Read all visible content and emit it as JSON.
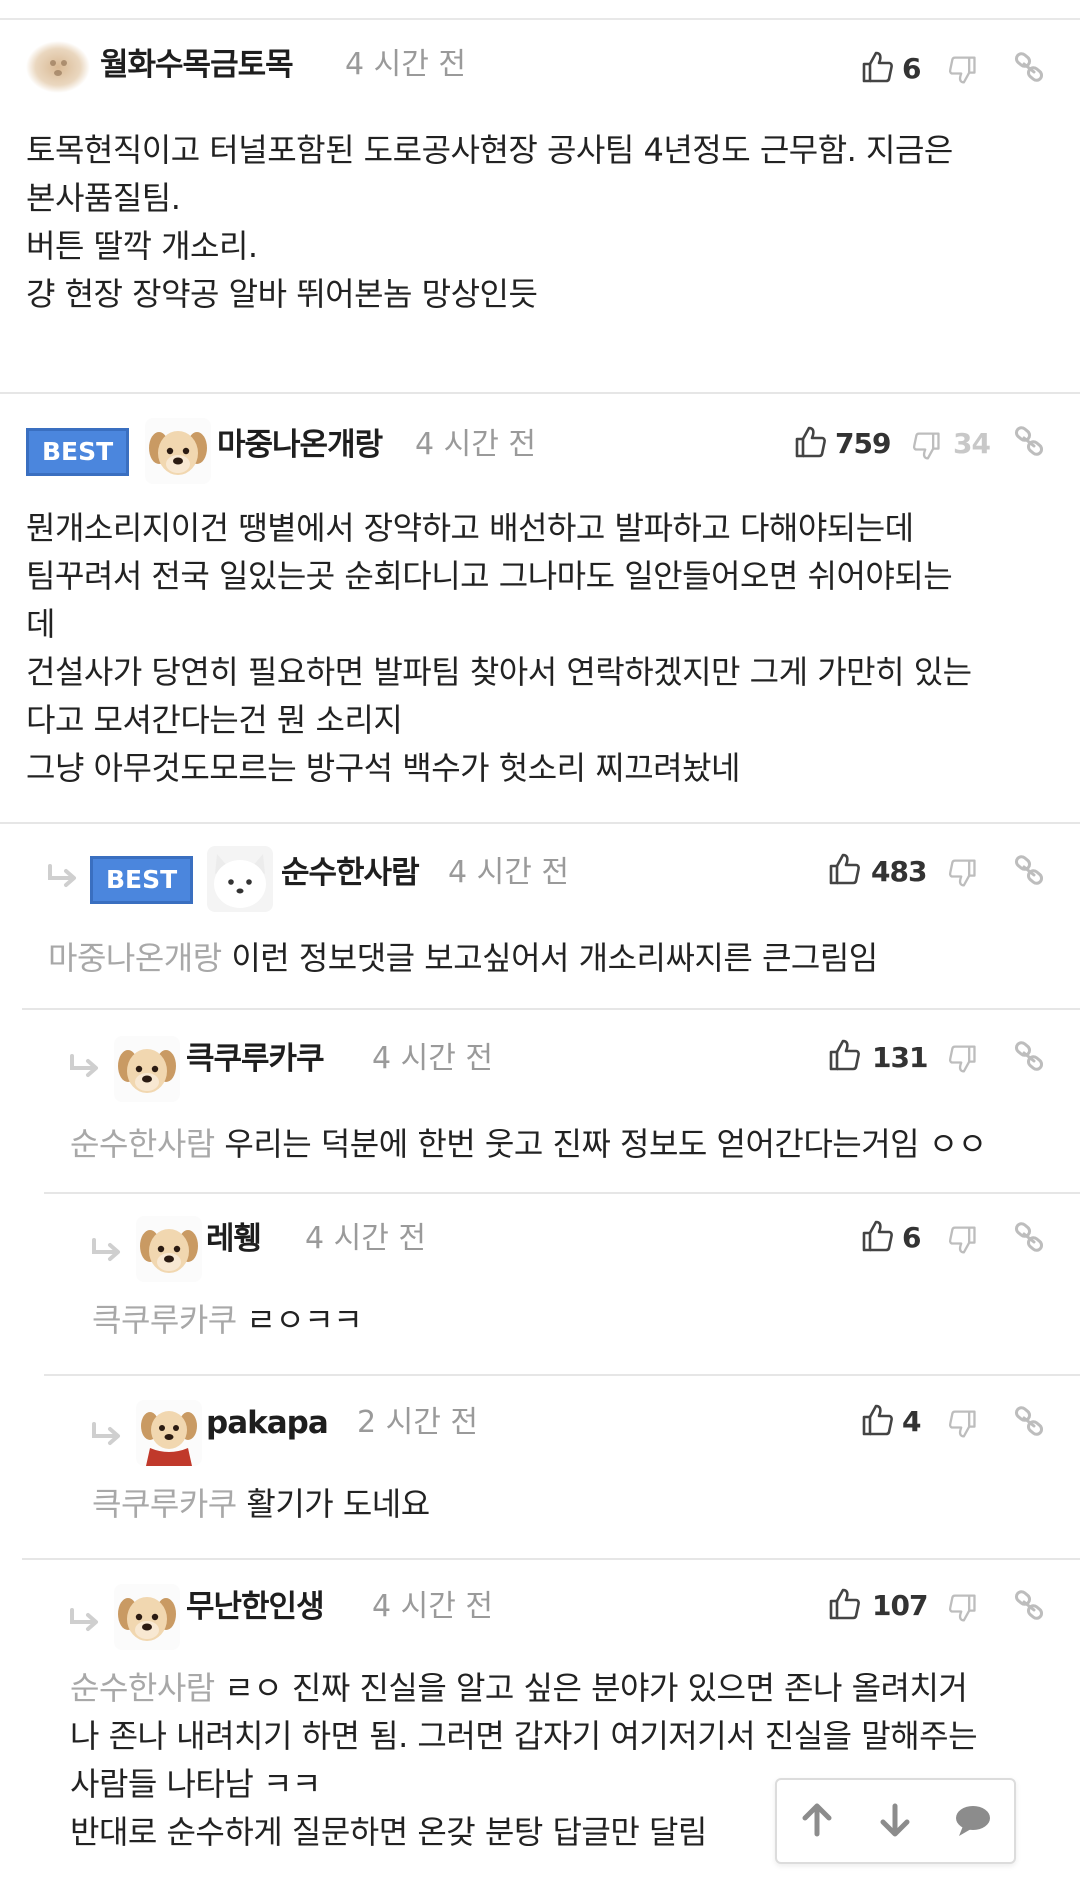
{
  "comments": [
    {
      "name": "월화수목금토목",
      "time": "4 시간 전",
      "up": "6",
      "down": "",
      "best": "",
      "mention": "",
      "lines": [
        "토목현직이고 터널포함된 도로공사현장 공사팀 4년정도 근무함. 지금은",
        "본사품질팀.",
        "",
        "버튼 딸깍 개소리.",
        "걍 현장 장약공 알바 뛰어본놈 망상인듯"
      ]
    },
    {
      "name": "마중나온개랑",
      "time": "4 시간 전",
      "up": "759",
      "down": "34",
      "best": "BEST",
      "mention": "",
      "lines": [
        "뭔개소리지이건 땡볕에서 장약하고 배선하고 발파하고 다해야되는데",
        "팀꾸려서 전국 일있는곳 순회다니고 그나마도 일안들어오면 쉬어야되는",
        "데",
        "건설사가 당연히 필요하면 발파팀 찾아서 연락하겠지만 그게 가만히 있는",
        "다고 모셔간다는건 뭔 소리지",
        "그냥 아무것도모르는 방구석 백수가 헛소리 찌끄려놨네"
      ]
    },
    {
      "name": "순수한사람",
      "time": "4 시간 전",
      "up": "483",
      "down": "",
      "best": "BEST",
      "mention": "마중나온개랑",
      "lines": [
        "이런 정보댓글 보고싶어서 개소리싸지른 큰그림임"
      ]
    },
    {
      "name": "큭쿠루카쿠",
      "time": "4 시간 전",
      "up": "131",
      "down": "",
      "best": "",
      "mention": "순수한사람",
      "lines": [
        "우리는 덕분에 한번 웃고 진짜 정보도 얻어간다는거임 ㅇㅇ"
      ]
    },
    {
      "name": "레휑",
      "time": "4 시간 전",
      "up": "6",
      "down": "",
      "best": "",
      "mention": "큭쿠루카쿠",
      "lines": [
        "ㄹㅇㅋㅋ"
      ]
    },
    {
      "name": "pakapa",
      "time": "2 시간 전",
      "up": "4",
      "down": "",
      "best": "",
      "mention": "큭쿠루카쿠",
      "lines": [
        "활기가 도네요"
      ]
    },
    {
      "name": "무난한인생",
      "time": "4 시간 전",
      "up": "107",
      "down": "",
      "best": "",
      "mention": "순수한사람",
      "lines": [
        "ㄹㅇ 진짜 진실을 알고 싶은 분야가 있으면 존나 올려치거",
        "나 존나 내려치기 하면 됨. 그러면 갑자기 여기저기서 진실을 말해주는",
        "사람들 나타남 ㅋㅋ",
        "반대로 순수하게 질문하면 온갖 분탕 답글만 달림"
      ]
    }
  ],
  "colors": {
    "best_bg": "#4b86dd",
    "mention": "#a8a8a8",
    "time": "#9a9a9a"
  },
  "icons": [
    "thumbs-up-icon",
    "thumbs-down-icon",
    "link-icon",
    "reply-arrow-icon",
    "scroll-up-icon",
    "scroll-down-icon",
    "chat-icon"
  ]
}
